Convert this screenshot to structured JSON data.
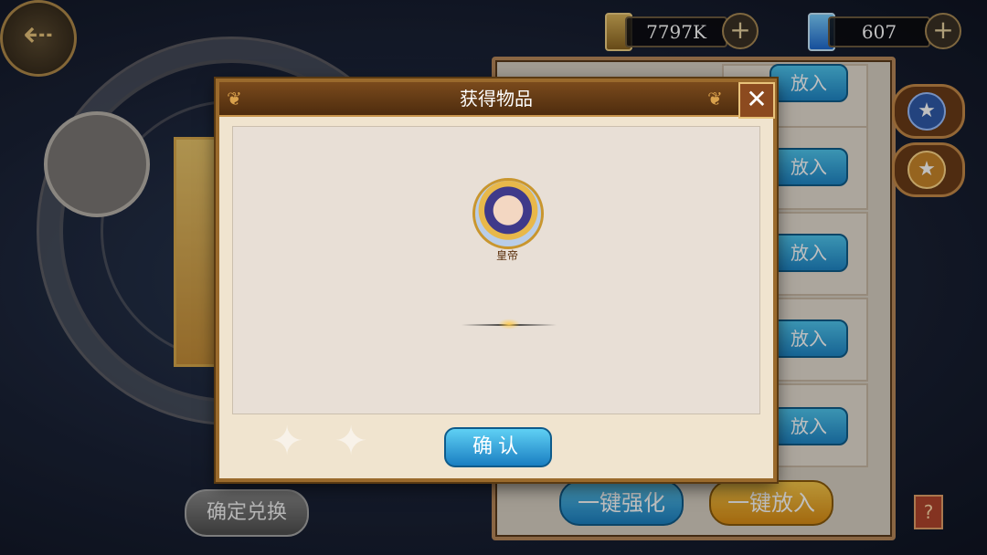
{
  "currency": {
    "gold_value": "7797K",
    "gem_value": "607",
    "plus_label": "+",
    "gold_icon": "gold-bar-icon",
    "gem_icon": "blue-gem-icon"
  },
  "right_panel": {
    "put_in_label": "放入",
    "one_click_enhance": "一键强化",
    "one_click_put_in": "一键放入"
  },
  "confirm_exchange": "确定兑换",
  "modal": {
    "title": "获得物品",
    "close_label": "✕",
    "item_name": "皇帝",
    "ok_label": "确认"
  },
  "colors": {
    "accent_blue": "#1f86c6",
    "accent_gold": "#e0a020",
    "frame_brown": "#9a6a2c"
  }
}
